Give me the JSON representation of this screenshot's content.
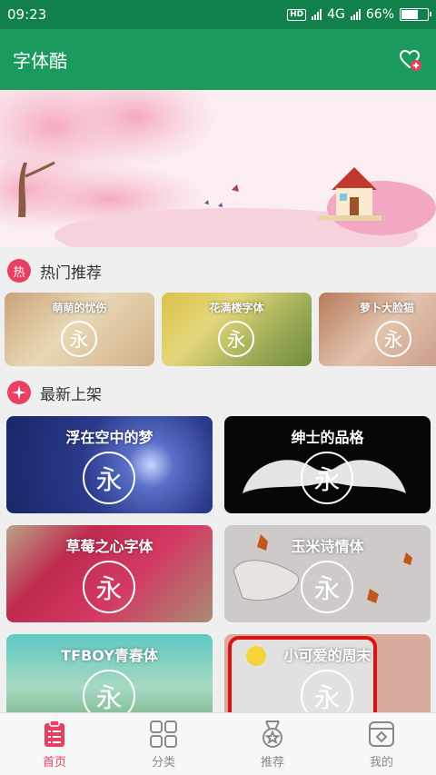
{
  "status_bar": {
    "time": "09:23",
    "network_hd": "HD",
    "network_type": "4G",
    "battery_percent": "66%",
    "battery_level": 0.66
  },
  "app_bar": {
    "title": "字体酷",
    "favorite_icon": "heart-plus-icon"
  },
  "banner": {
    "image": "pink-cherry-blossom-landscape"
  },
  "hot_section": {
    "icon_text": "热",
    "title": "热门推荐",
    "items": [
      {
        "name": "萌萌的忧伤",
        "glyph": "永"
      },
      {
        "name": "花满楼字体",
        "glyph": "永"
      },
      {
        "name": "萝卜大脸猫",
        "glyph": "永"
      }
    ]
  },
  "new_section": {
    "icon": "sparkle-icon",
    "title": "最新上架",
    "items": [
      {
        "name": "浮在空中的梦",
        "glyph": "永"
      },
      {
        "name": "绅士的品格",
        "glyph": "永"
      },
      {
        "name": "草莓之心字体",
        "glyph": "永"
      },
      {
        "name": "玉米诗情体",
        "glyph": "永"
      },
      {
        "name": "TFBOY青春体",
        "glyph": "永"
      },
      {
        "name": "小可爱的周末",
        "glyph": "永"
      }
    ]
  },
  "bottom_nav": {
    "items": [
      {
        "label": "首页",
        "icon": "clipboard-list-icon",
        "active": true
      },
      {
        "label": "分类",
        "icon": "grid-icon",
        "active": false
      },
      {
        "label": "推荐",
        "icon": "medal-icon",
        "active": false
      },
      {
        "label": "我的",
        "icon": "profile-card-icon",
        "active": false
      }
    ]
  },
  "colors": {
    "primary_green": "#1a9a5c",
    "status_green": "#12804a",
    "accent_red": "#e84060"
  }
}
